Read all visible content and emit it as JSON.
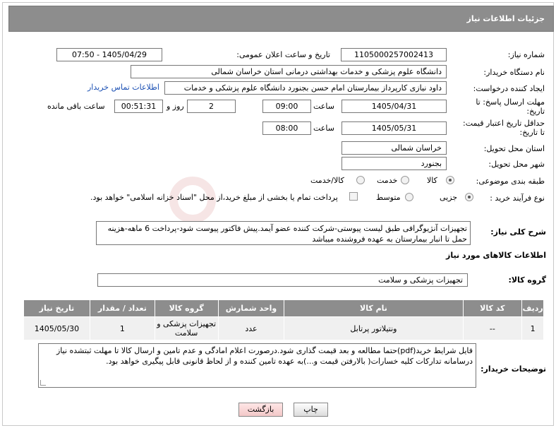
{
  "header": {
    "title": "جزئیات اطلاعات نیاز"
  },
  "fields": {
    "need_number_label": "شماره نیاز:",
    "need_number": "1105000257002413",
    "announce_label": "تاریخ و ساعت اعلان عمومی:",
    "announce_value": "1405/04/29 - 07:50",
    "buyer_org_label": "نام دستگاه خریدار:",
    "buyer_org": "دانشگاه علوم پزشکی و خدمات بهداشتی درمانی استان خراسان شمالی",
    "requester_label": "ایجاد کننده درخواست:",
    "requester": "داود نیازی کارپرداز بیمارستان امام حسن بجنورد دانشگاه علوم پزشکی و خدمات",
    "contact_link": "اطلاعات تماس خریدار",
    "deadline_label_1": "مهلت ارسال پاسخ: تا",
    "deadline_label_2": "تاریخ:",
    "deadline_date": "1405/04/31",
    "time_label": "ساعت",
    "deadline_time": "09:00",
    "days_value": "2",
    "days_label": "روز و",
    "remaining_time": "00:51:31",
    "remaining_label": "ساعت باقی مانده",
    "price_validity_label_1": "حداقل تاریخ اعتبار قیمت:",
    "price_validity_label_2": "تا تاریخ:",
    "price_validity_date": "1405/05/31",
    "price_validity_time": "08:00",
    "province_label": "استان محل تحویل:",
    "province": "خراسان شمالی",
    "city_label": "شهر محل تحویل:",
    "city": "بجنورد",
    "category_label": "طبقه بندی موضوعی:",
    "category_options": [
      "کالا",
      "خدمت",
      "کالا/خدمت"
    ],
    "category_selected": "کالا",
    "process_label": "نوع فرآیند خرید :",
    "process_options": [
      "جزیی",
      "متوسط"
    ],
    "process_selected": "جزیی",
    "treasury_note": "پرداخت تمام یا بخشی از مبلغ خرید،از محل \"اسناد خزانه اسلامی\" خواهد بود."
  },
  "description": {
    "label": "شرح کلی نیاز:",
    "text": "تجهیزات آنژیوگرافی طبق لیست پیوستی-شرکت کننده عضو آیمد.پیش فاکتور پیوست  شود-پرداخت 6 ماهه-هزینه حمل تا انبار بیمارستان به عهده فروشنده میباشد"
  },
  "goods_info": {
    "title": "اطلاعات کالاهای مورد نیاز",
    "group_label": "گروه کالا:",
    "group_value": "تجهیزات پزشکی و سلامت"
  },
  "table": {
    "headers": [
      "ردیف",
      "کد کالا",
      "نام کالا",
      "واحد شمارش",
      "گروه کالا",
      "تعداد / مقدار",
      "تاریخ نیاز"
    ],
    "rows": [
      [
        "1",
        "--",
        "ونتیلاتور پرتابل",
        "عدد",
        "تجهیزات پزشکی و سلامت",
        "1",
        "1405/05/30"
      ]
    ]
  },
  "buyer_notes": {
    "label": "توضیحات خریدار:",
    "text": "فایل شرایط خرید(pdf)حتما مطالعه و بعد قیمت گذاری شود.درصورت اعلام امادگی و عدم تامین و ارسال کالا تا مهلت ثبتشده نیاز درسامانه تدارکات کلیه خسارات( بالارفتن قیمت و...)به عهده تامین کننده و از لحاظ قانونی قابل پیگیری خواهد بود."
  },
  "buttons": {
    "print": "چاپ",
    "back": "بازگشت"
  },
  "colors": {
    "header_bg": "#8d8d8d",
    "link": "#1a4fb3",
    "back_button": "#f3c8c8"
  }
}
